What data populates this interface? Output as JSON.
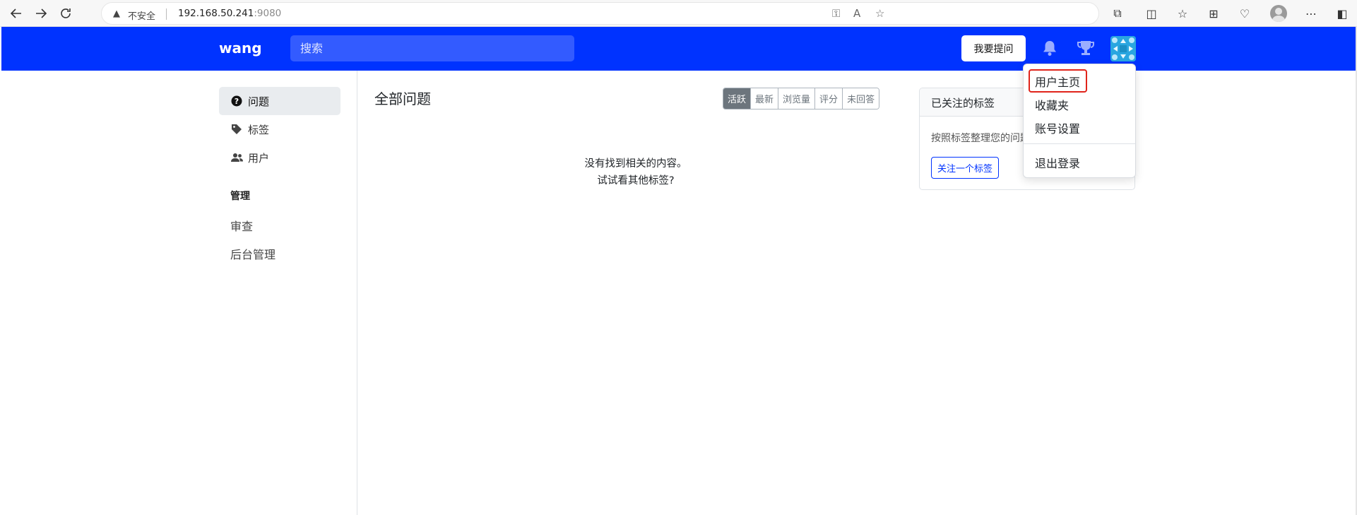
{
  "browser": {
    "insecure_label": "不安全",
    "url_host": "192.168.50.241",
    "url_port": ":9080"
  },
  "header": {
    "brand": "wang",
    "search_placeholder": "搜索",
    "ask_button": "我要提问",
    "brand_color": "#0033ff"
  },
  "sidebar": {
    "items": [
      {
        "label": "问题",
        "icon": "question-circle-icon",
        "active": true
      },
      {
        "label": "标签",
        "icon": "tags-icon",
        "active": false
      },
      {
        "label": "用户",
        "icon": "people-icon",
        "active": false
      }
    ],
    "admin_heading": "管理",
    "admin_links": [
      "审查",
      "后台管理"
    ]
  },
  "main": {
    "title": "全部问题",
    "sort_options": [
      "活跃",
      "最新",
      "浏览量",
      "评分",
      "未回答"
    ],
    "active_sort": "活跃",
    "empty_line1": "没有找到相关的内容。",
    "empty_line2": "试试看其他标签?"
  },
  "tags_card": {
    "title": "已关注的标签",
    "description": "按照标签整理您的问题",
    "button": "关注一个标签"
  },
  "dropdown": {
    "items": [
      "用户主页",
      "收藏夹",
      "账号设置",
      "退出登录"
    ]
  }
}
